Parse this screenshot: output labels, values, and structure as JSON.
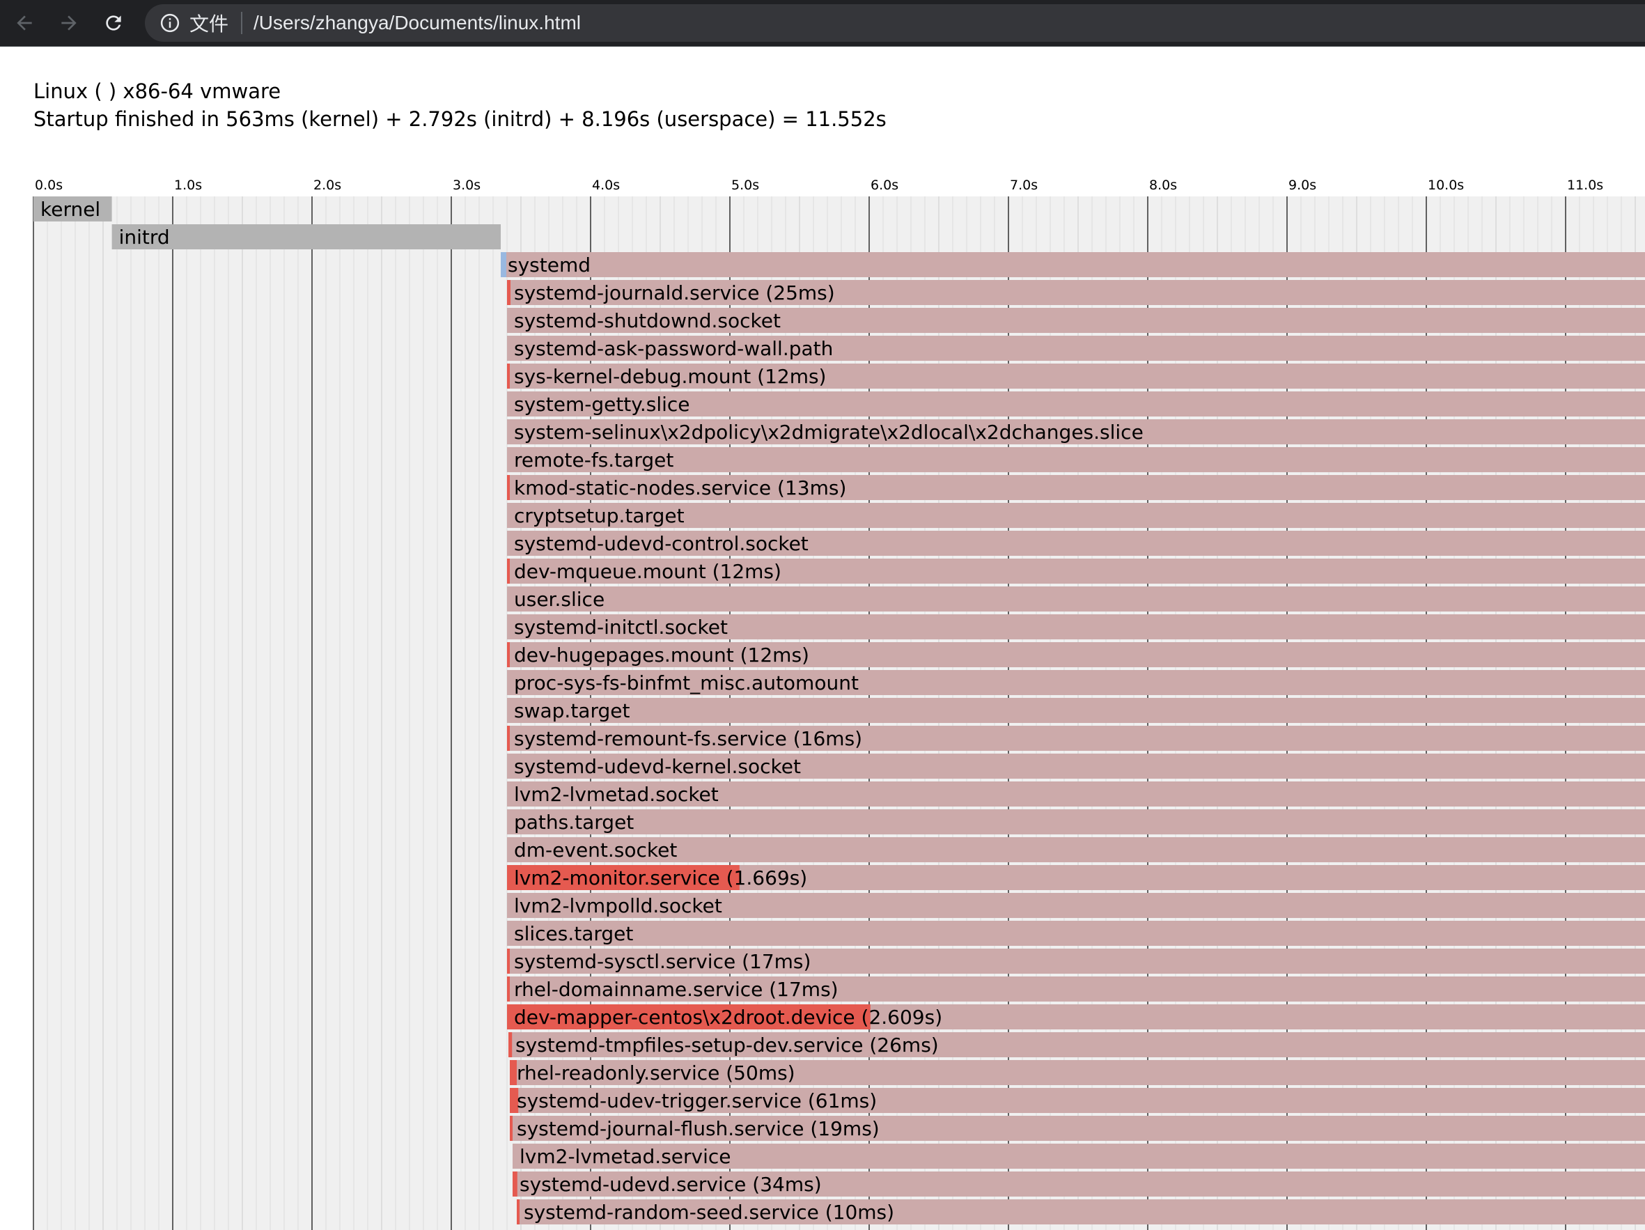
{
  "browser": {
    "back_icon": "arrow-left-icon",
    "forward_icon": "arrow-right-icon",
    "reload_icon": "reload-icon",
    "info_icon": "info-icon",
    "scheme_label": "文件",
    "url": "/Users/zhangya/Documents/linux.html"
  },
  "header": {
    "system": "Linux ( ) x86-64 vmware",
    "startup": "Startup finished in 563ms (kernel) + 2.792s (initrd) + 8.196s (userspace) = 11.552s"
  },
  "chart_data": {
    "type": "gantt",
    "x_unit": "s",
    "x_ticks": [
      "0.0s",
      "1.0s",
      "2.0s",
      "3.0s",
      "4.0s",
      "5.0s",
      "6.0s",
      "7.0s",
      "8.0s",
      "9.0s",
      "10.0s",
      "11.0s"
    ],
    "colors": {
      "kernel": "#b3b3b3",
      "initrd": "#b3b3b3",
      "systemd_marker": "#99b8e0",
      "active": "#ccaaaa",
      "activating": "#e55a50",
      "grid_bg": "#f0f0f0"
    },
    "units": [
      {
        "label": "kernel",
        "start": 0.0,
        "end": 0.563,
        "kind": "kernel"
      },
      {
        "label": "initrd",
        "start": 0.563,
        "end": 3.355,
        "kind": "initrd"
      },
      {
        "label": "systemd",
        "start": 3.355,
        "end": 11.6,
        "kind": "systemd"
      },
      {
        "label": "systemd-journald.service (25ms)",
        "start": 3.4,
        "activating": 0.025
      },
      {
        "label": "systemd-shutdownd.socket",
        "start": 3.4,
        "activating": 0
      },
      {
        "label": "systemd-ask-password-wall.path",
        "start": 3.4,
        "activating": 0
      },
      {
        "label": "sys-kernel-debug.mount (12ms)",
        "start": 3.4,
        "activating": 0.012
      },
      {
        "label": "system-getty.slice",
        "start": 3.4,
        "activating": 0
      },
      {
        "label": "system-selinux\\x2dpolicy\\x2dmigrate\\x2dlocal\\x2dchanges.slice",
        "start": 3.4,
        "activating": 0
      },
      {
        "label": "remote-fs.target",
        "start": 3.4,
        "activating": 0
      },
      {
        "label": "kmod-static-nodes.service (13ms)",
        "start": 3.4,
        "activating": 0.013
      },
      {
        "label": "cryptsetup.target",
        "start": 3.4,
        "activating": 0
      },
      {
        "label": "systemd-udevd-control.socket",
        "start": 3.4,
        "activating": 0
      },
      {
        "label": "dev-mqueue.mount (12ms)",
        "start": 3.4,
        "activating": 0.012
      },
      {
        "label": "user.slice",
        "start": 3.4,
        "activating": 0
      },
      {
        "label": "systemd-initctl.socket",
        "start": 3.4,
        "activating": 0
      },
      {
        "label": "dev-hugepages.mount (12ms)",
        "start": 3.4,
        "activating": 0.012
      },
      {
        "label": "proc-sys-fs-binfmt_misc.automount",
        "start": 3.4,
        "activating": 0
      },
      {
        "label": "swap.target",
        "start": 3.4,
        "activating": 0
      },
      {
        "label": "systemd-remount-fs.service (16ms)",
        "start": 3.4,
        "activating": 0.016
      },
      {
        "label": "systemd-udevd-kernel.socket",
        "start": 3.4,
        "activating": 0
      },
      {
        "label": "lvm2-lvmetad.socket",
        "start": 3.4,
        "activating": 0
      },
      {
        "label": "paths.target",
        "start": 3.4,
        "activating": 0
      },
      {
        "label": "dm-event.socket",
        "start": 3.4,
        "activating": 0
      },
      {
        "label": "lvm2-monitor.service (1.669s)",
        "start": 3.4,
        "activating": 1.669
      },
      {
        "label": "lvm2-lvmpolld.socket",
        "start": 3.4,
        "activating": 0
      },
      {
        "label": "slices.target",
        "start": 3.4,
        "activating": 0
      },
      {
        "label": "systemd-sysctl.service (17ms)",
        "start": 3.4,
        "activating": 0.017
      },
      {
        "label": "rhel-domainname.service (17ms)",
        "start": 3.4,
        "activating": 0.017
      },
      {
        "label": "dev-mapper-centos\\x2droot.device (2.609s)",
        "start": 3.4,
        "activating": 2.609
      },
      {
        "label": "systemd-tmpfiles-setup-dev.service (26ms)",
        "start": 3.41,
        "activating": 0.026
      },
      {
        "label": "rhel-readonly.service (50ms)",
        "start": 3.42,
        "activating": 0.05
      },
      {
        "label": "systemd-udev-trigger.service (61ms)",
        "start": 3.42,
        "activating": 0.061
      },
      {
        "label": "systemd-journal-flush.service (19ms)",
        "start": 3.42,
        "activating": 0.019
      },
      {
        "label": "lvm2-lvmetad.service",
        "start": 3.44,
        "activating": 0
      },
      {
        "label": "systemd-udevd.service (34ms)",
        "start": 3.44,
        "activating": 0.034
      },
      {
        "label": "systemd-random-seed.service (10ms)",
        "start": 3.47,
        "activating": 0.01
      }
    ]
  }
}
